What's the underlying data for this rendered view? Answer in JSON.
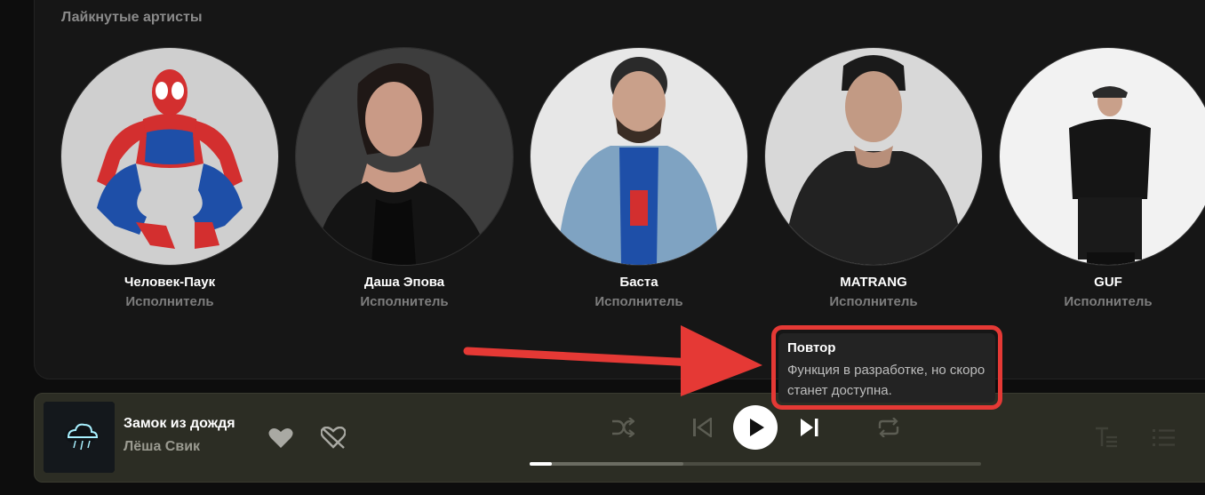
{
  "section": {
    "subtitle": "Лайкнутые артисты"
  },
  "artists": [
    {
      "name": "Человек-Паук",
      "role": "Исполнитель"
    },
    {
      "name": "Даша Эпова",
      "role": "Исполнитель"
    },
    {
      "name": "Баста",
      "role": "Исполнитель"
    },
    {
      "name": "MATRANG",
      "role": "Исполнитель"
    },
    {
      "name": "GUF",
      "role": "Исполнитель"
    }
  ],
  "player": {
    "track_title": "Замок из дождя",
    "track_artist": "Лёша Свик",
    "progress_fraction": 0.05,
    "buffered_fraction": 0.34,
    "icons": {
      "like": "heart-icon",
      "dislike": "heart-broken-icon",
      "shuffle": "shuffle-icon",
      "previous": "previous-icon",
      "play": "play-icon",
      "next": "next-icon",
      "repeat": "repeat-icon",
      "lyrics": "lyrics-icon",
      "queue": "queue-icon"
    }
  },
  "tooltip": {
    "title": "Повтор",
    "text": "Функция в разработке, но скоро станет доступна."
  },
  "colors": {
    "annotation": "#e53935",
    "player_bg": "#2c2d24",
    "panel_bg": "#161616"
  }
}
